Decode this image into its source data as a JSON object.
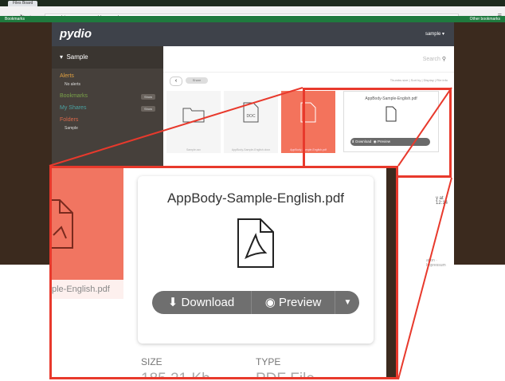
{
  "browser": {
    "tab_title": "Files Board",
    "url": "www.dotsomcompany.com/placeoon.php",
    "bookmarks_label": "Bookmarks",
    "other_bookmarks_label": "Other bookmarks"
  },
  "app": {
    "logo": "pydio",
    "user_menu": "sample",
    "workspace": "Sample",
    "search_placeholder": "Search",
    "share_label": "Share",
    "view_options": "Thumbs size | Sort by | Display | File info",
    "sidebar": {
      "alerts": "Alerts",
      "no_alerts": "No alerts",
      "bookmarks": "Bookmarks",
      "bookmarks_badge": "Show",
      "my_shares": "My Shares",
      "shares_badge": "Show",
      "folders": "Folders",
      "sample_folder": "Sample"
    },
    "tiles": [
      {
        "name": "Sample.csv"
      },
      {
        "name": "AppBody-Sample-English.docx"
      },
      {
        "name": "AppBody-Sample-English.pdf"
      }
    ],
    "side_text": {
      "date": "y at 12:14",
      "footer": "ation · Impressum"
    }
  },
  "zoom": {
    "left_file_name": "ple-English.pdf",
    "card_title": "AppBody-Sample-English.pdf",
    "download_label": "Download",
    "preview_label": "Preview",
    "size_label": "SIZE",
    "size_value": "185.21 Kb",
    "type_label": "TYPE",
    "type_value": "PDF File"
  },
  "colors": {
    "highlight": "#e8392c",
    "header": "#3e424a",
    "sidebar": "#46403b",
    "selected_tile": "#f3735c",
    "button_bar": "#6f6f6f",
    "bookmarks_bar": "#1f7a3e"
  },
  "icons": {
    "download": "download-icon",
    "preview": "eye-icon",
    "dropdown": "caret-down-icon",
    "file": "pdf-file-icon",
    "search": "search-icon"
  }
}
